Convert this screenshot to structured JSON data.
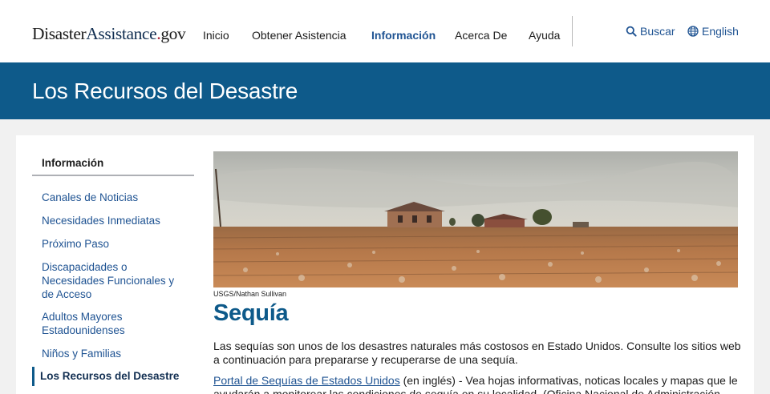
{
  "header": {
    "logo": {
      "part1": "Disaster",
      "part2": "Assistance",
      "part3": ".",
      "part4": "gov"
    },
    "nav": [
      "Inicio",
      "Obtener Asistencia",
      "Información",
      "Acerca De",
      "Ayuda"
    ],
    "active_nav": "Información",
    "search_label": "Buscar",
    "language_label": "English"
  },
  "banner": {
    "title": "Los Recursos del Desastre"
  },
  "sidebar": {
    "title": "Información",
    "items": [
      "Canales de Noticias",
      "Necesidades Inmediatas",
      "Próximo Paso",
      "Discapacidades o Necesidades Funcionales y de Acceso",
      "Adultos Mayores Estadounidenses",
      "Niños y Familias",
      "Los Recursos del Desastre"
    ],
    "current": "Los Recursos del Desastre"
  },
  "main": {
    "image_credit": "USGS/Nathan Sullivan",
    "heading": "Sequía",
    "intro": "Las sequías son unos de los desastres naturales más costosos en Estado Unidos. Consulte los sitios web a continuación para prepararse y recuperarse de una sequía.",
    "link_text": "Portal de Sequías de Estados Unidos",
    "link_rest": " (en inglés) - Vea hojas informativas, noticas locales y mapas que le ayudarán a monitorear las condiciones de sequía en su localidad. (Oficina Nacional de Administración"
  },
  "colors": {
    "banner": "#0e5a8a",
    "link": "#205493",
    "heading": "#0e5a8a",
    "logo_dot": "#a8182d"
  }
}
